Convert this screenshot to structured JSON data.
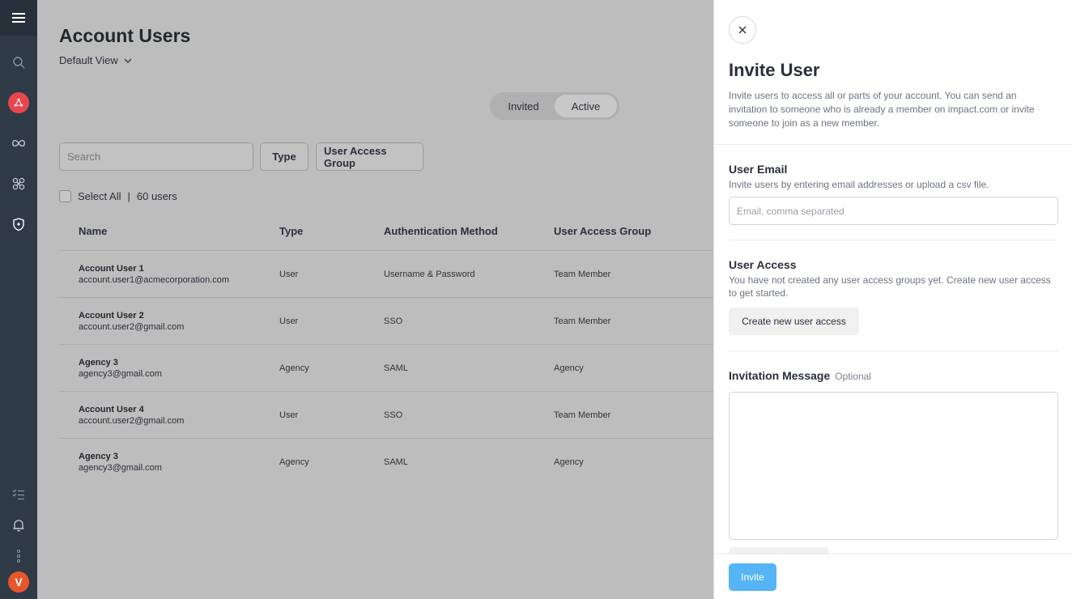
{
  "nav": {
    "icons": [
      "menu-icon",
      "search-icon",
      "brand-logo-icon",
      "infinity-icon",
      "network-icon",
      "shield-icon",
      "checklist-icon",
      "bell-icon",
      "more-dots-icon"
    ],
    "avatar_letter": "V",
    "accent": "#e8464d",
    "avatar_color": "#e8562a"
  },
  "main": {
    "title": "Account Users",
    "view": "Default View",
    "segment": {
      "invited": "Invited",
      "active": "Active"
    },
    "search_placeholder": "Search",
    "filters": {
      "type": "Type",
      "group": "User Access Group"
    },
    "select_all": "Select All",
    "separator": "|",
    "user_count": "60 users",
    "columns": [
      "Name",
      "Type",
      "Authentication Method",
      "User Access Group"
    ],
    "rows": [
      {
        "name": "Account User 1",
        "email": "account.user1@acmecorporation.com",
        "type": "User",
        "auth": "Username & Password",
        "group": "Team Member"
      },
      {
        "name": "Account User 2",
        "email": "account.user2@gmail.com",
        "type": "User",
        "auth": "SSO",
        "group": "Team Member"
      },
      {
        "name": "Agency 3",
        "email": "agency3@gmail.com",
        "type": "Agency",
        "auth": "SAML",
        "group": "Agency"
      },
      {
        "name": "Account User 4",
        "email": "account.user2@gmail.com",
        "type": "User",
        "auth": "SSO",
        "group": "Team Member"
      },
      {
        "name": "Agency 3",
        "email": "agency3@gmail.com",
        "type": "Agency",
        "auth": "SAML",
        "group": "Agency"
      }
    ]
  },
  "drawer": {
    "title": "Invite User",
    "description": "Invite users to access all or parts of your account. You can send an invitation to someone who is already a member on impact.com or invite someone to join as a new member.",
    "email_section": {
      "title": "User Email",
      "subtitle": "Invite users by entering email addresses or upload a csv file.",
      "placeholder": "Email, comma separated"
    },
    "access_section": {
      "title": "User Access",
      "subtitle": "You have not created any user access groups yet. Create new user access to get started.",
      "button": "Create new user access"
    },
    "message_section": {
      "title": "Invitation Message",
      "optional": "Optional"
    },
    "invite_button": "Invite",
    "invite_color": "#55b4f5"
  }
}
